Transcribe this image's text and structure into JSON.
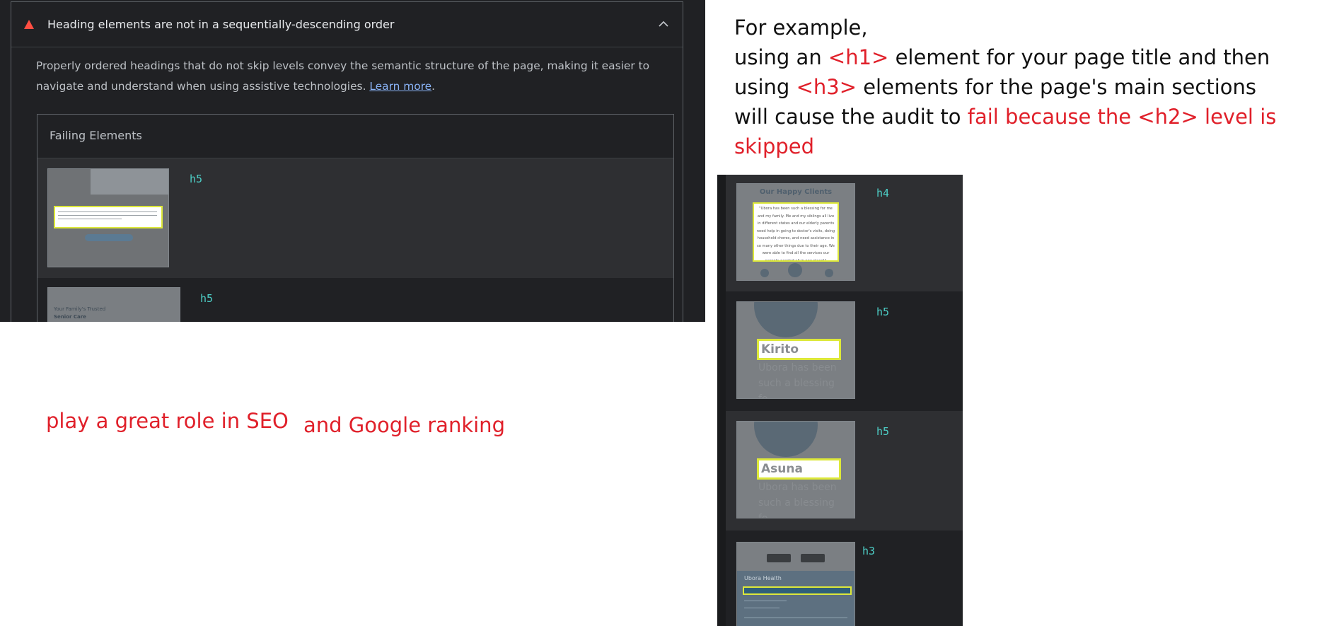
{
  "audit": {
    "title": "Heading elements are not in a sequentially-descending order",
    "description": "Properly ordered headings that do not skip levels convey the semantic structure of the page, making it easier to navigate and understand when using assistive technologies.",
    "learn_more": "Learn more",
    "description_end": ".",
    "failing_title": "Failing Elements",
    "rows": [
      {
        "tag": "h5"
      },
      {
        "tag": "h5"
      }
    ],
    "thumb_row2_text1": "Your Family's Trusted",
    "thumb_row2_text2": "Senior Care"
  },
  "note": {
    "line1": "For example,",
    "line2_a": "using an ",
    "line2_b": "<h1>",
    "line2_c": " element for your page title and then",
    "line3_a": "using ",
    "line3_b": "<h3>",
    "line3_c": " elements for the page's main sections",
    "line4_a": "will cause the audit to ",
    "line4_b": "fail because the <h2> level is",
    "line5": "skipped"
  },
  "side_notes": {
    "seo": "play a great role in SEO",
    "ranking": "and Google ranking"
  },
  "strip": {
    "rows": [
      {
        "tag": "h4",
        "thumb_title": "Our Happy Clients",
        "thumb_quote": "\"Ubora has been such a blessing for me and my family. Me and my siblings all live in different states and our elderly parents need help in going to doctor's visits, doing household chores, and need assistance in so many other things due to their age. We were able to find all the services our parents needed all in one place!\""
      },
      {
        "tag": "h5",
        "name": "Kirito",
        "ghost1": "Ubora has been",
        "ghost2": "such a blessing fo..."
      },
      {
        "tag": "h5",
        "name": "Asuna",
        "ghost1": "Ubora has been",
        "ghost2": "such a blessing fo..."
      },
      {
        "tag": "h3",
        "brand": "Ubora Health"
      }
    ]
  },
  "colors": {
    "panel_bg": "#202124",
    "row_bg": "#2e2f32",
    "tag": "#4dd0c8",
    "fail": "#ff4e42",
    "highlight": "#dde83a",
    "annotation_red": "#e0202a"
  }
}
